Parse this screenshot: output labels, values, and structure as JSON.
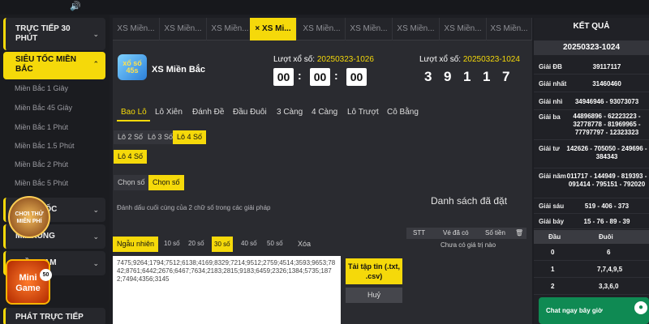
{
  "sidebar": {
    "groups": [
      {
        "label": "TRỰC TIẾP 30 PHÚT"
      },
      {
        "label": "SIÊU TỐC MIỀN BẮC",
        "items": [
          "Miền Bắc 1 Giây",
          "Miền Bắc 45 Giây",
          "Miền Bắc 1 Phút",
          "Miền Bắc 1.5 Phút",
          "Miền Bắc 2 Phút",
          "Miền Bắc 5 Phút"
        ]
      },
      {
        "label": "...ỐC"
      },
      {
        "label": "MI...RUNG"
      },
      {
        "label": "MIỀN NAM"
      },
      {
        "label": "PHÁT TRỰC TIẾP"
      }
    ]
  },
  "tabs": [
    "XS Miền...",
    "XS Miền...",
    "XS Miền...",
    "XS Mi...",
    "XS Miền...",
    "XS Miền...",
    "XS Miền...",
    "XS Miền...",
    "XS Miền..."
  ],
  "active_tab_close": "×",
  "game": {
    "logo_text": "xổ số 45s",
    "name": "XS Miền Bắc"
  },
  "countdown": {
    "label": "Lượt xổ số:",
    "draw_id": "20250323-1026",
    "hh": "00",
    "mm": "00",
    "ss": "00"
  },
  "result": {
    "label": "Lượt xổ số:",
    "draw_id": "20250323-1024",
    "digits": [
      "3",
      "9",
      "1",
      "1",
      "7"
    ]
  },
  "bet_types": [
    "Bao Lô",
    "Lô Xiên",
    "Đánh Đề",
    "Đầu Đuôi",
    "3 Càng",
    "4 Càng",
    "Lô Trượt",
    "Cô Bằng"
  ],
  "sub_types": [
    "Lô 2 Số",
    "Lô 3 Số",
    "Lô 4 Số"
  ],
  "sub_types_row2": [
    "Lô 4 Số"
  ],
  "choose": [
    "Chọn số",
    "Chọn số"
  ],
  "hint": "Đánh dấu cuối cùng của 2 chữ số trong các giải pháp",
  "random": {
    "label": "Ngẫu nhiên",
    "options": [
      "10 số",
      "20 số",
      "30 số",
      "40 số",
      "50 số"
    ],
    "clear": "Xóa"
  },
  "numbers_text": "7475;9264;1794;7512;6138;4169;8329;7214;9512;2759;4514;3593;9653;7842;8761;6442;2676;6467;7634;2183;2815;9183;6459;2326;1384;5735;1872;7494;4356;3145",
  "upload_label": "Tải tập tin (.txt, .csv)",
  "cancel_label": "Huỷ",
  "list": {
    "title": "Danh sách đã đặt",
    "headers": [
      "STT",
      "Vé đã có",
      "Số tiền"
    ],
    "empty": "Chưa có giá trị nào"
  },
  "results_panel": {
    "title": "KẾT QUẢ",
    "draw_id": "20250323-1024",
    "prizes": [
      {
        "name": "Giải ĐB",
        "value": "39117117"
      },
      {
        "name": "Giải nhất",
        "value": "31460460"
      },
      {
        "name": "Giải nhì",
        "value": "34946946 - 93073073"
      },
      {
        "name": "Giải ba",
        "value": "44896896 - 62223223 - 32778778 - 81969965 - 77797797 - 12323323"
      },
      {
        "name": "Giải tư",
        "value": "142626 - 705050 - 249696 - 384343"
      },
      {
        "name": "Giải năm",
        "value": "011717 - 144949 - 819393 - 091414 - 795151 - 792020"
      },
      {
        "name": "Giải sáu",
        "value": "519 - 406 - 373"
      },
      {
        "name": "Giải bảy",
        "value": "15 - 76 - 89 - 39"
      }
    ],
    "table_headers": [
      "Đầu",
      "Đuôi"
    ],
    "table_rows": [
      {
        "head": "0",
        "tail": "6"
      },
      {
        "head": "1",
        "tail": "7,7,4,9,5"
      },
      {
        "head": "2",
        "tail": "3,3,6,0"
      }
    ]
  },
  "chat": {
    "label": "Chat ngay bây giờ"
  },
  "promo": {
    "label": "CHƠI THỬ MIỄN PHÍ"
  },
  "mini_game": {
    "label": "Mini Game",
    "badge": "50"
  }
}
